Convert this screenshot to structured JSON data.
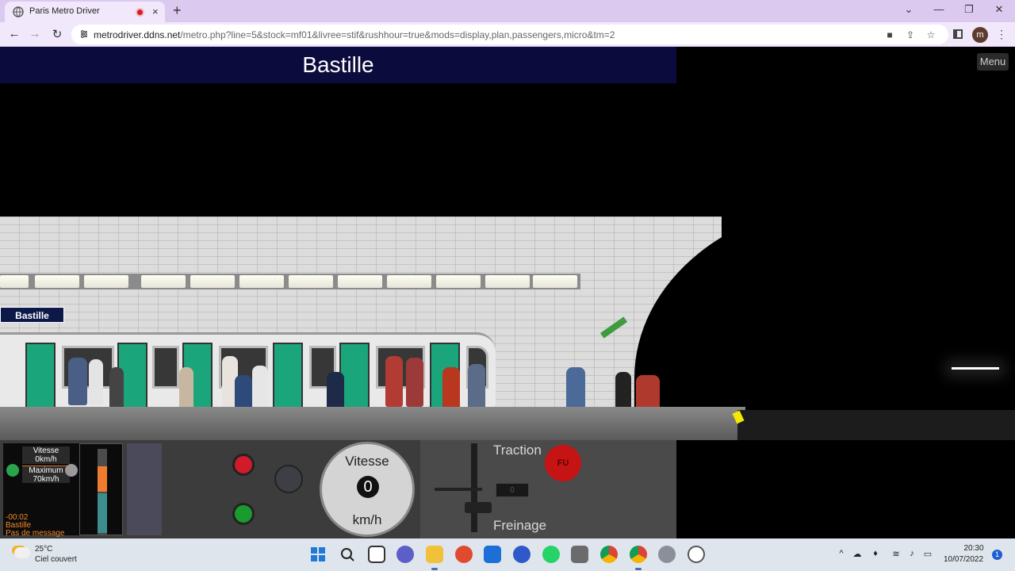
{
  "browser": {
    "tab_title": "Paris Metro Driver",
    "new_tab": "+",
    "close_tab": "×",
    "url_host": "metrodriver.ddns.net",
    "url_path": "/metro.php?line=5&stock=mf01&livree=stif&rushhour=true&mods=display,plan,passengers,micro&tm=2",
    "profile_initial": "m",
    "window": {
      "minimize": "—",
      "maximize": "❐",
      "close": "✕",
      "dropdown": "⌄"
    },
    "nav": {
      "back": "←",
      "forward": "→",
      "reload": "↻"
    }
  },
  "game": {
    "station_header": "Bastille",
    "menu_label": "Menu",
    "station_sign": "Bastille"
  },
  "cab": {
    "speed_label": "Vitesse",
    "speed_value": "0km/h",
    "max_label": "Maximum",
    "max_value": "70km/h",
    "timer": "-00:02",
    "next_station": "Bastille",
    "message": "Pas de message",
    "speedometer": {
      "label": "Vitesse",
      "value": "0",
      "unit": "km/h"
    },
    "traction_label": "Traction",
    "freinage_label": "Freinage",
    "fu_label": "FU",
    "digit_display": "0",
    "gauge_level_top": 0.3,
    "gauge_level_bottom": 0.45
  },
  "taskbar": {
    "weather_temp": "25°C",
    "weather_desc": "Ciel couvert",
    "clock_time": "20:30",
    "clock_date": "10/07/2022",
    "notifications": "1",
    "apps": [
      "start-icon",
      "search-icon",
      "file-manager-icon",
      "teams-icon",
      "file-explorer-icon",
      "app-red-icon",
      "mail-icon",
      "m-app-icon",
      "whatsapp-icon",
      "apps-icon",
      "chrome-icon",
      "chrome-profile-icon",
      "settings-icon",
      "app-clock-icon"
    ]
  },
  "colors": {
    "header_bg": "#0c0b3d",
    "tab_bar": "#dcc9f0",
    "signal_red": "#d11b2b",
    "signal_green": "#1a9b2e",
    "fu_red": "#c61313",
    "info_orange": "#f08a2c"
  }
}
